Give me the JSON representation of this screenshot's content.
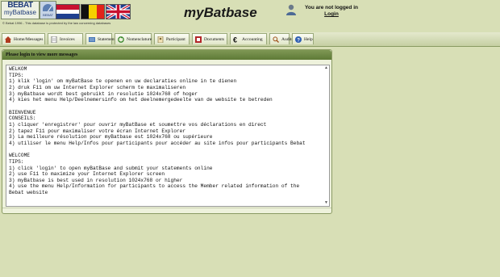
{
  "header": {
    "logo_line1": "BEBAT",
    "logo_line2": "myBatbase",
    "gauge_caption": "BEBAT",
    "copyright": "© Bebat 1996 - This database is protected by the law concerning databases",
    "app_title": "myBatbase",
    "login_status": "You are not logged in",
    "login_link": "Login",
    "flag_nl_colors": [
      "#c8102e",
      "#ffffff",
      "#1f3f8f"
    ],
    "flag_be_colors": [
      "#111111",
      "#f5d000",
      "#e2231a"
    ]
  },
  "nav": {
    "tabs": [
      {
        "label": "Home/Messages",
        "icon": "home-icon"
      },
      {
        "label": "Invoices",
        "icon": "document-icon"
      },
      {
        "label": "Statements",
        "icon": "statements-icon"
      },
      {
        "label": "Nomenclature",
        "icon": "nomenclature-icon"
      },
      {
        "label": "Participant",
        "icon": "participant-icon"
      },
      {
        "label": "Documents",
        "icon": "documents-icon"
      },
      {
        "label": "Accounting",
        "icon": "euro-icon"
      },
      {
        "label": "Audits",
        "icon": "audit-icon"
      },
      {
        "label": "Help",
        "icon": "help-icon"
      }
    ]
  },
  "messages": {
    "heading": "Please login to view more messages",
    "body": "WELKOM\nTIPS:\n1) klik 'login' om myBatBase te openen en uw declaraties online in te dienen\n2) druk F11 om uw Internet Explorer scherm te maximaliseren\n3) myBatbase wordt best gebruikt in resolutie 1024x768 of hoger\n4) kies het menu Help/Deelnemersinfo om het deelnemergedeelte van de website te betreden\n\nBIENVENUE\nCONSEILS:\n1) cliquer 'enregistrer' pour ouvrir myBatBase et soumettre vos déclarations en direct\n2) tapez F11 pour maximaliser votre écran Internet Explorer\n3) La meilleure résolution pour myBatbase est 1024x768 ou supérieure\n4) utiliser le menu Help/Infos pour participants pour accéder au site infos pour participants Bebat\n\nWELCOME\nTIPS:\n1) click 'login' to open myBatBase and submit your statements online\n2) use F11 to maximize your Internet Explorer screen\n3) myBatbase is best used in resolution 1024x768 or higher\n4) use the menu Help/Information for participants to access the Member related information of the\nBebat website"
  }
}
